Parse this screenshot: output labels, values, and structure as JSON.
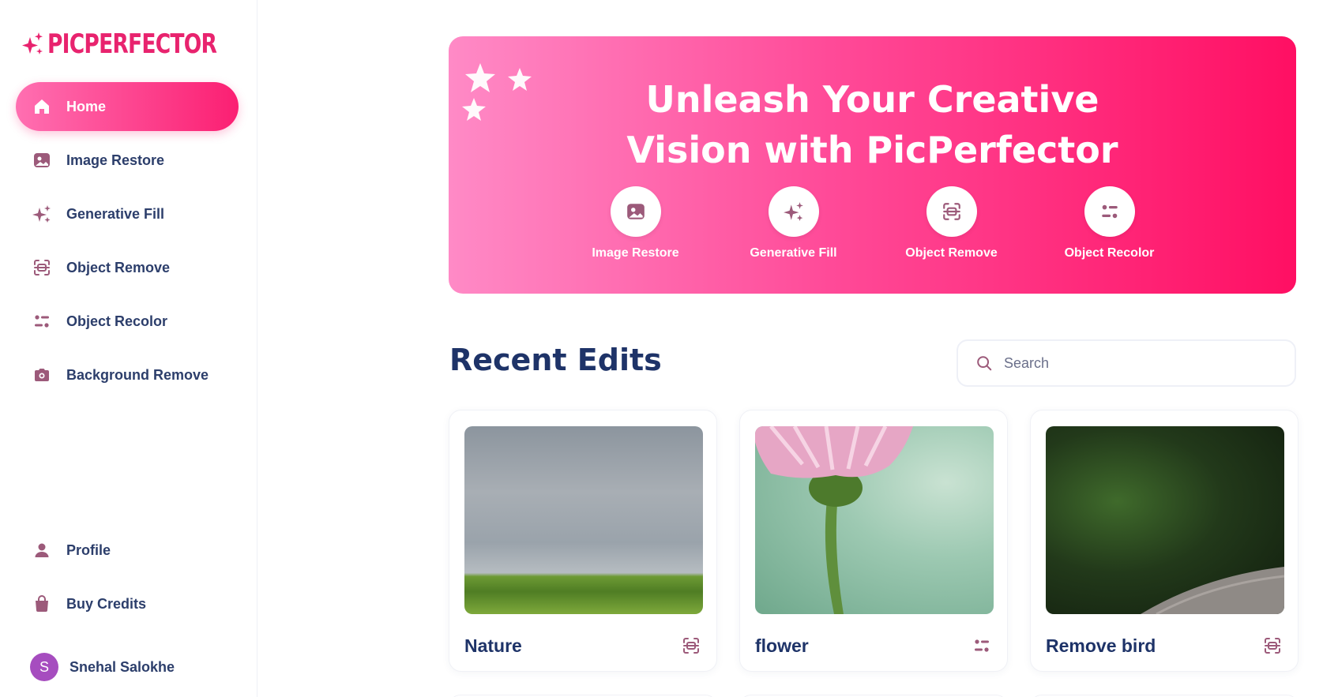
{
  "app": {
    "logo_text": "PICPERFECTOR"
  },
  "colors": {
    "accent": "#fb1f72",
    "accent_light": "#ff6fb1",
    "navy": "#1e3368",
    "icon_mauve": "#9c5a7a",
    "avatar": "#a64dbf"
  },
  "sidebar": {
    "items": [
      {
        "label": "Home",
        "icon": "home-icon",
        "active": true
      },
      {
        "label": "Image Restore",
        "icon": "image-icon"
      },
      {
        "label": "Generative Fill",
        "icon": "sparkles-icon"
      },
      {
        "label": "Object Remove",
        "icon": "scan-icon"
      },
      {
        "label": "Object Recolor",
        "icon": "recolor-icon"
      },
      {
        "label": "Background Remove",
        "icon": "camera-icon"
      }
    ],
    "bottom_items": [
      {
        "label": "Profile",
        "icon": "user-icon"
      },
      {
        "label": "Buy Credits",
        "icon": "bag-icon"
      }
    ],
    "user": {
      "initial": "S",
      "name": "Snehal Salokhe"
    }
  },
  "hero": {
    "title_line1": "Unleash Your Creative",
    "title_line2": "Vision with PicPerfector",
    "tools": [
      {
        "label": "Image Restore",
        "icon": "image-icon"
      },
      {
        "label": "Generative Fill",
        "icon": "sparkles-icon"
      },
      {
        "label": "Object Remove",
        "icon": "scan-icon"
      },
      {
        "label": "Object Recolor",
        "icon": "recolor-icon"
      }
    ]
  },
  "recent": {
    "title": "Recent Edits",
    "search_placeholder": "Search",
    "cards": [
      {
        "name": "Nature",
        "icon": "scan-icon"
      },
      {
        "name": "flower",
        "icon": "recolor-icon"
      },
      {
        "name": "Remove bird",
        "icon": "scan-icon"
      }
    ]
  }
}
